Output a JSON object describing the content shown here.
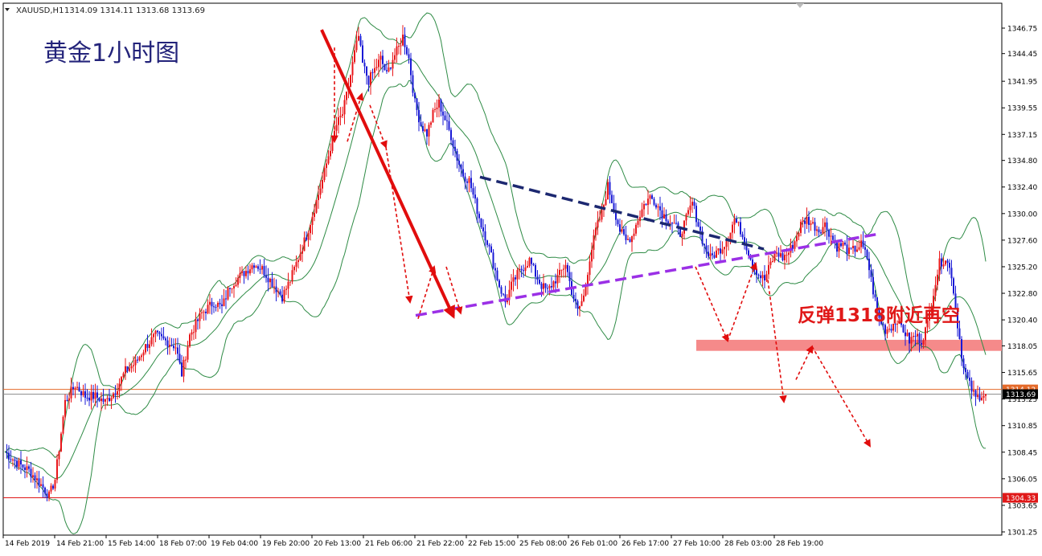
{
  "header": {
    "symbol": "XAUUSD,H1",
    "ohlc": "1314.09 1314.11 1313.68 1313.69"
  },
  "annotations": {
    "chart_title": "黄金1小时图",
    "plan_text": "反弹1318附近再空"
  },
  "colors": {
    "bull_candle": "#e8161a",
    "bear_candle": "#1a1ad6",
    "bollinger": "#2e8b45",
    "downtrend_arrow": "#e10d0d",
    "resistance_line": "#1c2870",
    "support_line": "#9b30e6",
    "zone": "#f58a8a",
    "title_text": "#23237a",
    "plan_text": "#e01818"
  },
  "chart_data": {
    "type": "candlestick",
    "symbol": "XAUUSD",
    "timeframe": "H1",
    "ylim": [
      1301.25,
      1348.5
    ],
    "y_ticks": [
      "1346.75",
      "1344.45",
      "1341.95",
      "1339.55",
      "1337.15",
      "1334.80",
      "1332.40",
      "1330.00",
      "1327.60",
      "1325.20",
      "1322.80",
      "1320.40",
      "1318.05",
      "1315.65",
      "1313.25",
      "1310.85",
      "1308.45",
      "1306.05",
      "1303.65",
      "1301.25"
    ],
    "x_ticks": [
      "14 Feb 2019",
      "14 Feb 21:00",
      "15 Feb 14:00",
      "18 Feb 07:00",
      "19 Feb 04:00",
      "19 Feb 20:00",
      "20 Feb 13:00",
      "21 Feb 06:00",
      "21 Feb 22:00",
      "22 Feb 15:00",
      "25 Feb 08:00",
      "26 Feb 01:00",
      "26 Feb 17:00",
      "27 Feb 10:00",
      "28 Feb 03:00",
      "28 Feb 19:00"
    ],
    "price_levels": [
      {
        "label": "1314.12",
        "value": 1314.12,
        "color": "#e46a2a"
      },
      {
        "label": "1313.69",
        "value": 1313.69,
        "color": "#000000",
        "current": true
      },
      {
        "label": "1304.33",
        "value": 1304.33,
        "color": "#e01818"
      }
    ],
    "zone": {
      "from": 1317.6,
      "to": 1318.6
    },
    "path": [
      [
        0,
        1308.5
      ],
      [
        6,
        1307.5
      ],
      [
        12,
        1306.8
      ],
      [
        18,
        1305.5
      ],
      [
        22,
        1304.5
      ],
      [
        25,
        1306
      ],
      [
        30,
        1313
      ],
      [
        35,
        1314.5
      ],
      [
        40,
        1313.5
      ],
      [
        45,
        1313.5
      ],
      [
        50,
        1313
      ],
      [
        55,
        1314
      ],
      [
        60,
        1315.8
      ],
      [
        65,
        1316.5
      ],
      [
        70,
        1318
      ],
      [
        75,
        1319
      ],
      [
        80,
        1318.5
      ],
      [
        85,
        1318
      ],
      [
        88,
        1315.5
      ],
      [
        92,
        1319
      ],
      [
        98,
        1321
      ],
      [
        104,
        1322
      ],
      [
        108,
        1321.5
      ],
      [
        112,
        1323.5
      ],
      [
        118,
        1324.5
      ],
      [
        124,
        1325.5
      ],
      [
        128,
        1325
      ],
      [
        132,
        1324
      ],
      [
        136,
        1323
      ],
      [
        138,
        1322.5
      ],
      [
        142,
        1324
      ],
      [
        146,
        1326
      ],
      [
        150,
        1328
      ],
      [
        154,
        1330.5
      ],
      [
        158,
        1333
      ],
      [
        162,
        1336
      ],
      [
        165,
        1338
      ],
      [
        168,
        1339
      ],
      [
        171,
        1341.5
      ],
      [
        174,
        1344.5
      ],
      [
        176,
        1346
      ],
      [
        178,
        1343.5
      ],
      [
        181,
        1342
      ],
      [
        184,
        1343
      ],
      [
        187,
        1344
      ],
      [
        190,
        1342.5
      ],
      [
        193,
        1344
      ],
      [
        196,
        1345
      ],
      [
        198,
        1346
      ],
      [
        201,
        1344
      ],
      [
        204,
        1340
      ],
      [
        207,
        1338
      ],
      [
        210,
        1337.2
      ],
      [
        213,
        1339
      ],
      [
        216,
        1340
      ],
      [
        219,
        1338.5
      ],
      [
        222,
        1337
      ],
      [
        225,
        1335
      ],
      [
        228,
        1333.5
      ],
      [
        231,
        1333
      ],
      [
        234,
        1331
      ],
      [
        237,
        1329
      ],
      [
        240,
        1327.5
      ],
      [
        243,
        1325.5
      ],
      [
        246,
        1323.5
      ],
      [
        249,
        1322
      ],
      [
        252,
        1323.5
      ],
      [
        255,
        1324.5
      ],
      [
        258,
        1325.2
      ],
      [
        261,
        1325.8
      ],
      [
        264,
        1324.5
      ],
      [
        267,
        1323.5
      ],
      [
        270,
        1323
      ],
      [
        273,
        1323.8
      ],
      [
        276,
        1324.5
      ],
      [
        279,
        1325.5
      ],
      [
        282,
        1323
      ],
      [
        285,
        1321.2
      ],
      [
        288,
        1322.5
      ],
      [
        291,
        1326
      ],
      [
        294,
        1328.5
      ],
      [
        297,
        1330
      ],
      [
        300,
        1332.5
      ],
      [
        303,
        1330.5
      ],
      [
        306,
        1328.5
      ],
      [
        309,
        1327.5
      ],
      [
        312,
        1328
      ],
      [
        315,
        1329.5
      ],
      [
        318,
        1330.8
      ],
      [
        321,
        1331.5
      ],
      [
        324,
        1331
      ],
      [
        327,
        1330
      ],
      [
        330,
        1329.5
      ],
      [
        333,
        1329
      ],
      [
        336,
        1328.2
      ],
      [
        339,
        1329.5
      ],
      [
        342,
        1331
      ],
      [
        345,
        1329
      ],
      [
        348,
        1327
      ],
      [
        351,
        1326
      ],
      [
        354,
        1326.5
      ],
      [
        357,
        1327
      ],
      [
        360,
        1328
      ],
      [
        363,
        1329.5
      ],
      [
        366,
        1328.5
      ],
      [
        369,
        1327
      ],
      [
        372,
        1325.5
      ],
      [
        375,
        1324.5
      ],
      [
        378,
        1324
      ],
      [
        381,
        1325.5
      ],
      [
        384,
        1326.5
      ],
      [
        387,
        1326
      ],
      [
        390,
        1326.5
      ],
      [
        393,
        1327.5
      ],
      [
        396,
        1329
      ],
      [
        399,
        1329.5
      ],
      [
        402,
        1329
      ],
      [
        405,
        1328.5
      ],
      [
        408,
        1329
      ],
      [
        411,
        1328
      ],
      [
        414,
        1327
      ],
      [
        417,
        1327.2
      ],
      [
        420,
        1326.5
      ],
      [
        423,
        1326.8
      ],
      [
        426,
        1327.2
      ],
      [
        429,
        1326
      ],
      [
        432,
        1323
      ],
      [
        435,
        1320.5
      ],
      [
        438,
        1319.5
      ],
      [
        441,
        1319.8
      ],
      [
        444,
        1320.5
      ],
      [
        447,
        1319.5
      ],
      [
        450,
        1318.5
      ],
      [
        453,
        1319
      ],
      [
        456,
        1318.5
      ],
      [
        459,
        1320
      ],
      [
        462,
        1323
      ],
      [
        465,
        1325.5
      ],
      [
        468,
        1326
      ],
      [
        471,
        1324.5
      ],
      [
        474,
        1320
      ],
      [
        477,
        1316
      ],
      [
        480,
        1314.5
      ],
      [
        483,
        1313.3
      ],
      [
        486,
        1313.7
      ],
      [
        488,
        1313.69
      ]
    ]
  }
}
